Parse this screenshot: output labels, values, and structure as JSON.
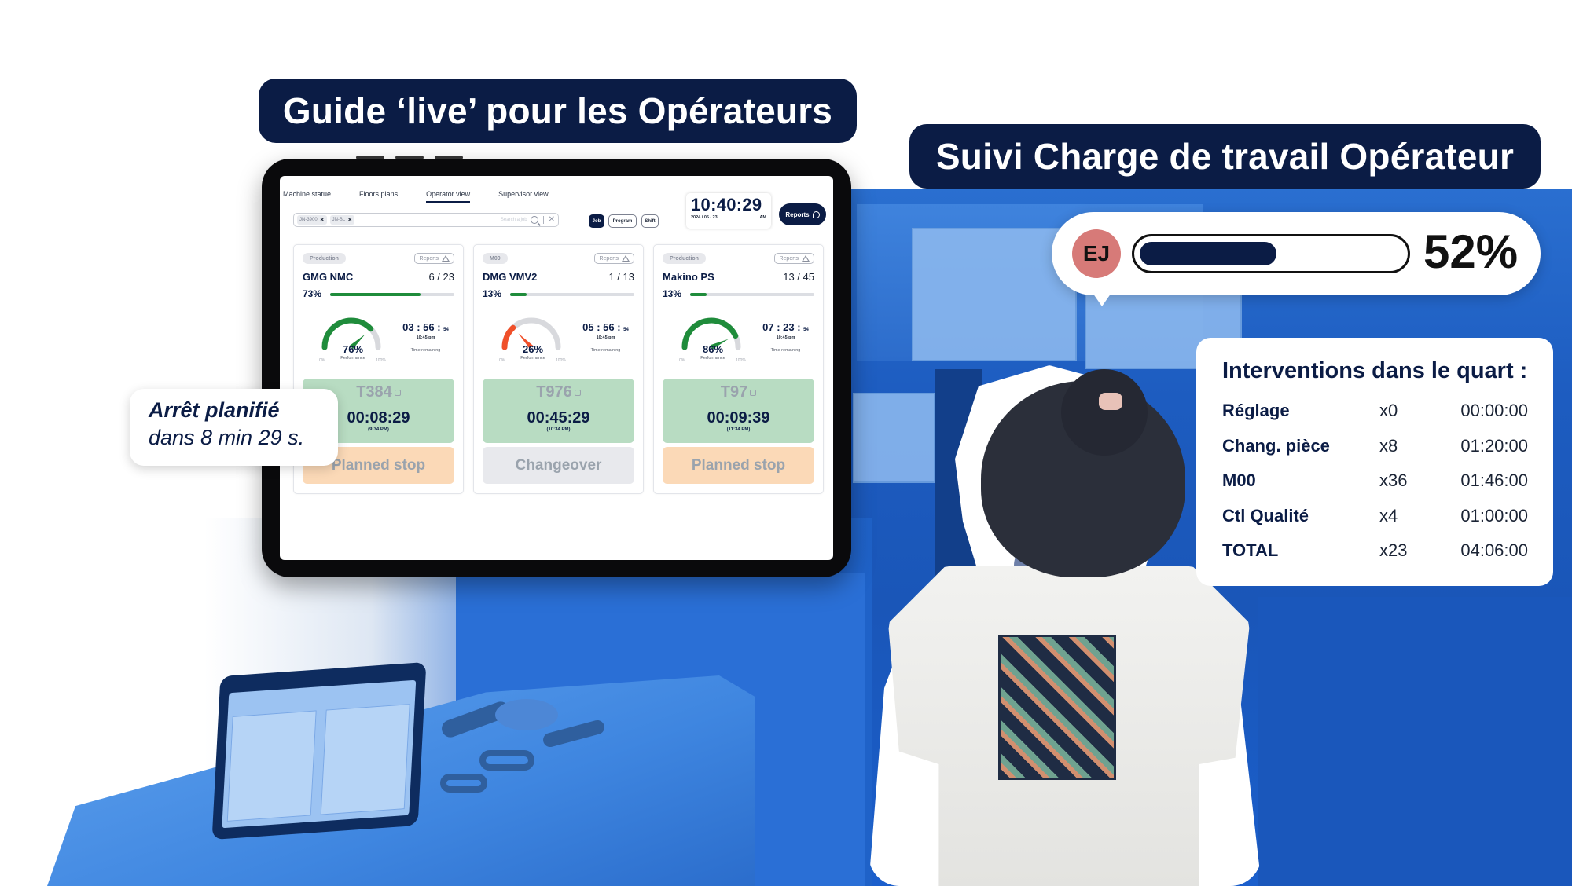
{
  "banners": {
    "left_title": "Guide ‘live’ pour les Opérateurs",
    "right_title": "Suivi Charge de travail Opérateur"
  },
  "tablet": {
    "nav_tabs": [
      {
        "label": "Machine statue",
        "active": false
      },
      {
        "label": "Floors plans",
        "active": false
      },
      {
        "label": "Operator view",
        "active": true
      },
      {
        "label": "Supervisor view",
        "active": false
      }
    ],
    "search": {
      "chips": [
        {
          "label": "JN-3900"
        },
        {
          "label": "JN-BL"
        }
      ],
      "placeholder": "Search a job"
    },
    "filters": [
      {
        "label": "Job",
        "active": true
      },
      {
        "label": "Program",
        "active": false
      },
      {
        "label": "Shift",
        "active": false
      }
    ],
    "clock": {
      "time": "10:40:29",
      "date": "2024 / 05 / 23",
      "ampm": "AM"
    },
    "reports_label": "Reports",
    "machines": [
      {
        "tag": "Production",
        "reports": "Reports",
        "name": "GMG NMC",
        "count": "6 / 23",
        "progress_pct": 73,
        "progress_label": "73%",
        "performance_pct": 76,
        "performance_label": "76%",
        "performance_caption": "Performance",
        "gauge_min": "0%",
        "gauge_max": "100%",
        "gauge_color": "#1f8c3b",
        "remaining_hm": "03 : 56 :",
        "remaining_s": "54",
        "remaining_end": "10:45 pm",
        "remaining_caption": "Time remaining",
        "job_id": "T384",
        "job_time": "00:08:29",
        "job_end": "(9:34 PM)",
        "status": "Planned stop",
        "status_color": "#fbd9b7"
      },
      {
        "tag": "M00",
        "reports": "Reports",
        "name": "DMG VMV2",
        "count": "1 / 13",
        "progress_pct": 13,
        "progress_label": "13%",
        "performance_pct": 26,
        "performance_label": "26%",
        "performance_caption": "Performance",
        "gauge_min": "0%",
        "gauge_max": "100%",
        "gauge_color": "#f0502a",
        "remaining_hm": "05 : 56 :",
        "remaining_s": "54",
        "remaining_end": "10:45 pm",
        "remaining_caption": "Time remaining",
        "job_id": "T976",
        "job_time": "00:45:29",
        "job_end": "(10:34 PM)",
        "status": "Changeover",
        "status_color": "#e8e9ed"
      },
      {
        "tag": "Production",
        "reports": "Reports",
        "name": "Makino PS",
        "count": "13 / 45",
        "progress_pct": 13,
        "progress_label": "13%",
        "performance_pct": 86,
        "performance_label": "86%",
        "performance_caption": "Performance",
        "gauge_min": "0%",
        "gauge_max": "100%",
        "gauge_color": "#1f8c3b",
        "remaining_hm": "07 : 23 :",
        "remaining_s": "54",
        "remaining_end": "10:45 pm",
        "remaining_caption": "Time remaining",
        "job_id": "T97",
        "job_time": "00:09:39",
        "job_end": "(11:34 PM)",
        "status": "Planned stop",
        "status_color": "#fbd9b7"
      }
    ]
  },
  "callout_arret": {
    "title": "Arrêt planifié",
    "subtitle": "dans 8 min 29 s."
  },
  "workload": {
    "initials": "EJ",
    "percent": 52,
    "percent_label": "52%",
    "avatar_color": "#d77a78",
    "bar_color": "#0b1c45"
  },
  "interventions": {
    "title": "Interventions dans le quart :",
    "rows": [
      {
        "label": "Réglage",
        "count": "x0",
        "duration": "00:00:00"
      },
      {
        "label": "Chang. pièce",
        "count": "x8",
        "duration": "01:20:00"
      },
      {
        "label": "M00",
        "count": "x36",
        "duration": "01:46:00"
      },
      {
        "label": "Ctl Qualité",
        "count": "x4",
        "duration": "01:00:00"
      },
      {
        "label": "TOTAL",
        "count": "x23",
        "duration": "04:06:00"
      }
    ]
  },
  "colors": {
    "navy": "#0b1c45",
    "green": "#1f8c3b",
    "red": "#f0502a",
    "job_green": "#b8dcc2"
  }
}
